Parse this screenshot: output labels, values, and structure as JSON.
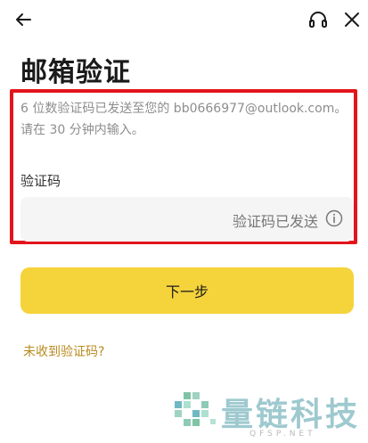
{
  "page": {
    "title": "邮箱验证",
    "description_line1": "6 位数验证码已发送至您的 bb0666977@outlook.com。",
    "description_line2": "请在 30 分钟内输入。",
    "code_label": "验证码",
    "code_hint": "验证码已发送",
    "next_button": "下一步",
    "resend_link": "未收到验证码?"
  },
  "watermark": {
    "name": "量链科技",
    "domain": "QFSP.NET"
  },
  "icons": {
    "back": "arrow-left-icon",
    "support": "headset-icon",
    "close": "close-icon",
    "info": "info-circle-icon"
  },
  "colors": {
    "accent": "#f5d33b",
    "link": "#b88a1e",
    "highlight": "#e3141c"
  }
}
